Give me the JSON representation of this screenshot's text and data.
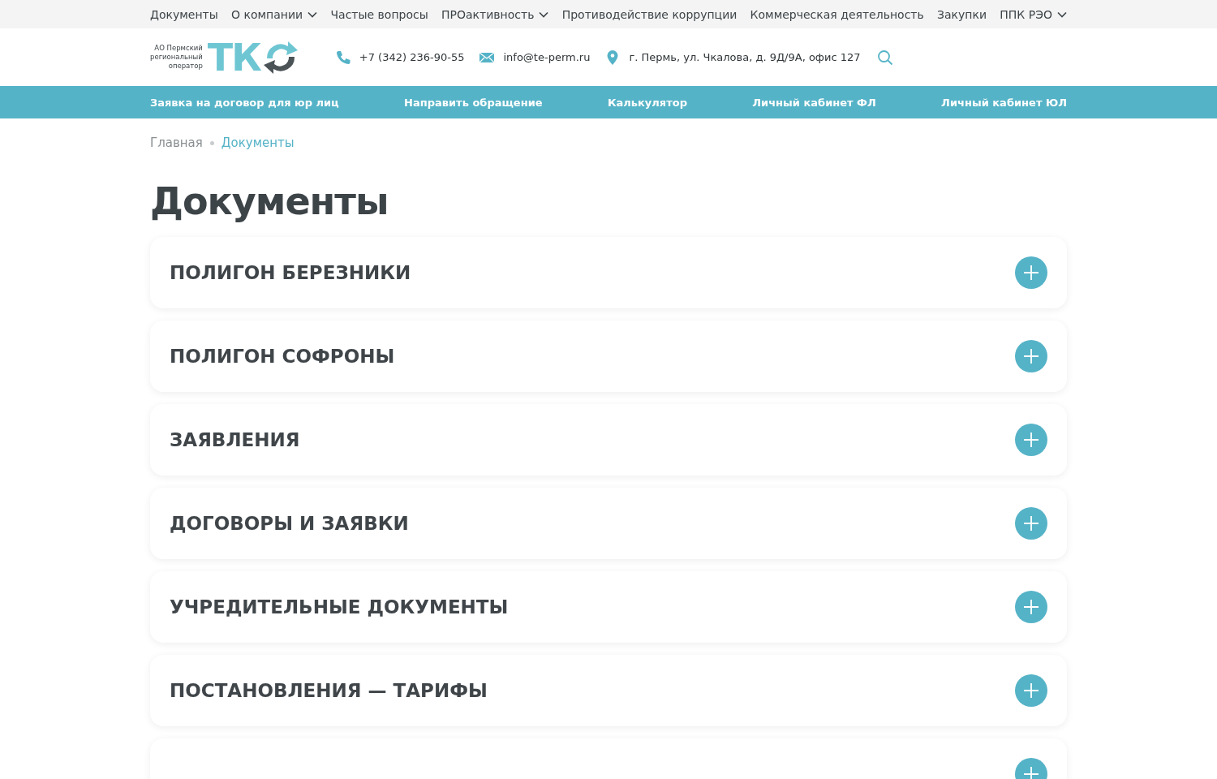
{
  "top_nav": [
    {
      "label": "Документы",
      "has_menu": false
    },
    {
      "label": "О компании",
      "has_menu": true
    },
    {
      "label": "Частые вопросы",
      "has_menu": false
    },
    {
      "label": "ПРОактивность",
      "has_menu": true
    },
    {
      "label": "Противодействие коррупции",
      "has_menu": false
    },
    {
      "label": "Коммерческая деятельность",
      "has_menu": false
    },
    {
      "label": "Закупки",
      "has_menu": false
    },
    {
      "label": "ППК РЭО",
      "has_menu": true
    }
  ],
  "header": {
    "logo_caption": [
      "АО Пермский",
      "региональный",
      "оператор"
    ],
    "logo_mark": "ТК",
    "contacts": [
      {
        "kind": "phone",
        "text": "+7 (342) 236-90-55"
      },
      {
        "kind": "email",
        "text": "info@te-perm.ru"
      },
      {
        "kind": "address",
        "text": "г. Пермь, ул. Чкалова, д. 9Д/9А, офис 127"
      }
    ]
  },
  "action_bar": [
    "Заявка на договор для юр лиц",
    "Направить обращение",
    "Калькулятор",
    "Личный кабинет ФЛ",
    "Личный кабинет ЮЛ"
  ],
  "breadcrumbs": [
    {
      "label": "Главная",
      "selected": false
    },
    {
      "label": "Документы",
      "selected": true
    }
  ],
  "title": "Документы",
  "sections": [
    {
      "title": "ПОЛИГОН БЕРЕЗНИКИ",
      "expanded": false
    },
    {
      "title": "ПОЛИГОН СОФРОНЫ",
      "expanded": false
    },
    {
      "title": "ЗАЯВЛЕНИЯ",
      "expanded": false
    },
    {
      "title": "ДОГОВОРЫ И ЗАЯВКИ",
      "expanded": false
    },
    {
      "title": "УЧРЕДИТЕЛЬНЫЕ ДОКУМЕНТЫ",
      "expanded": false
    },
    {
      "title": "ПОСТАНОВЛЕНИЯ — ТАРИФЫ",
      "expanded": false
    },
    {
      "expanded": false
    }
  ]
}
